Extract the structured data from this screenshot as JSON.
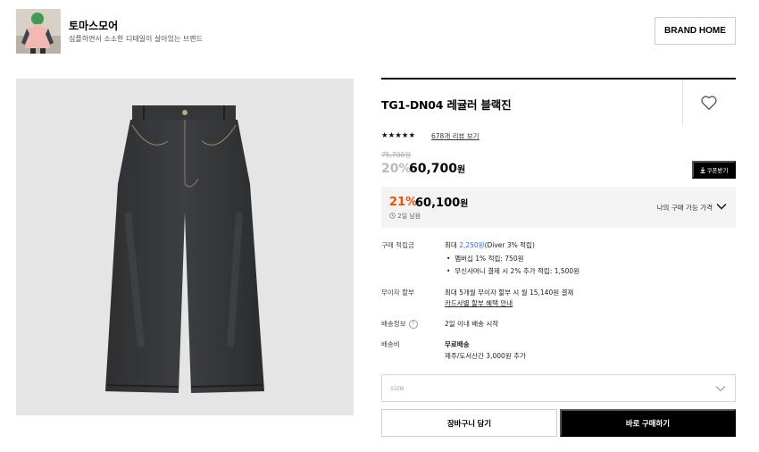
{
  "brand": {
    "name": "토마스모어",
    "description": "심플하면서 소소한 디테일이 살아있는 브랜드",
    "home_button": "BRAND HOME"
  },
  "product": {
    "title": "TG1-DN04 레귤러 블랙진",
    "rating_stars": "★★★★★",
    "review_link": "678개 리뷰 보기",
    "original_price": "75,700원",
    "discount_percent": "20%",
    "sale_price": "60,700",
    "sale_currency": "원",
    "coupon_button": "쿠폰받기",
    "coupon_icon": "download-icon"
  },
  "best_price": {
    "percent": "21%",
    "price": "60,100",
    "currency": "원",
    "remaining": "2일 남음",
    "label": "나의 구매 가능 가격"
  },
  "info": {
    "points": {
      "label": "구매 적립금",
      "max_prefix": "최대 ",
      "max_amount": "2,250원",
      "max_suffix": "(Diver 3% 적립)",
      "items": [
        "멤버십 1% 적립: 750원",
        "무신사머니 결제 시 2% 추가 적립: 1,500원"
      ]
    },
    "installment": {
      "label": "무이자 할부",
      "value": "최대 5개월 무이자 할부 시 월 15,140원 결제",
      "link": "카드사별 할부 혜택 안내"
    },
    "shipping": {
      "label": "배송정보",
      "help_icon": "?",
      "value": "2일 이내 배송 시작"
    },
    "shipping_fee": {
      "label": "배송비",
      "value": "무료배송",
      "sub": "제주/도서산간 3,000원 추가"
    }
  },
  "size_select": {
    "placeholder": "size"
  },
  "buttons": {
    "cart": "장바구니 담기",
    "buy": "바로 구매하기"
  },
  "colors": {
    "accent_orange": "#f04e00",
    "link_blue": "#2f6cf5",
    "image_bg": "#e5e5e5"
  }
}
